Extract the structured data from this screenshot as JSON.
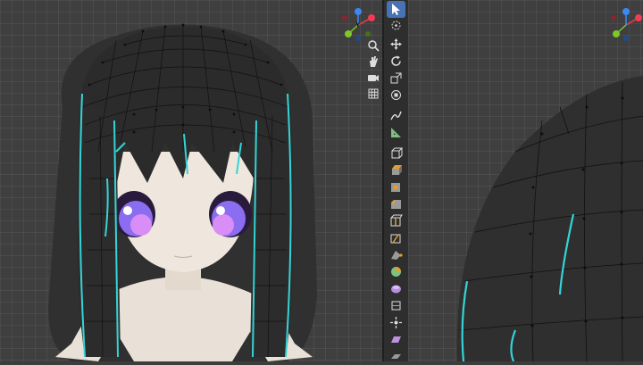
{
  "app": "Blender",
  "colors": {
    "viewport_bg": "#3f3f3f",
    "toolbar_bg": "#2e2e2e",
    "active_tool": "#4772b3",
    "mesh_dark": "#2b2b2b",
    "selected_edge": "#35d3d6",
    "skin": "#efe6dc",
    "eye": "#8a6df0"
  },
  "toolbar": {
    "tools": [
      {
        "name": "select-tool",
        "icon": "cursor-arrow-icon",
        "active": true
      },
      {
        "name": "cursor-tool",
        "icon": "3d-cursor-icon",
        "active": false
      },
      {
        "name": "move-tool",
        "icon": "move-arrows-icon",
        "active": false
      },
      {
        "name": "rotate-tool",
        "icon": "rotate-icon",
        "active": false
      },
      {
        "name": "scale-tool",
        "icon": "scale-icon",
        "active": false
      },
      {
        "name": "transform-tool",
        "icon": "transform-icon",
        "active": false
      },
      {
        "name": "annotate-tool",
        "icon": "pencil-icon",
        "active": false
      },
      {
        "name": "measure-tool",
        "icon": "ruler-icon",
        "active": false
      },
      {
        "name": "add-cube-tool",
        "icon": "add-cube-icon",
        "active": false
      },
      {
        "name": "extrude-tool",
        "icon": "extrude-icon",
        "active": false
      },
      {
        "name": "inset-tool",
        "icon": "inset-faces-icon",
        "active": false
      },
      {
        "name": "bevel-tool",
        "icon": "bevel-icon",
        "active": false
      },
      {
        "name": "loop-cut-tool",
        "icon": "loop-cut-icon",
        "active": false
      },
      {
        "name": "knife-tool",
        "icon": "knife-icon",
        "active": false
      },
      {
        "name": "poly-build-tool",
        "icon": "poly-build-icon",
        "active": false
      },
      {
        "name": "spin-tool",
        "icon": "spin-icon",
        "active": false
      },
      {
        "name": "smooth-tool",
        "icon": "smooth-vertices-icon",
        "active": false
      },
      {
        "name": "edge-slide-tool",
        "icon": "edge-slide-icon",
        "active": false
      },
      {
        "name": "shrink-fatten-tool",
        "icon": "shrink-fatten-icon",
        "active": false
      },
      {
        "name": "shear-tool",
        "icon": "shear-icon",
        "active": false
      },
      {
        "name": "rip-region-tool",
        "icon": "rip-region-icon",
        "active": false
      }
    ]
  },
  "navigation": {
    "buttons": [
      {
        "name": "zoom-button",
        "icon": "magnifier-icon"
      },
      {
        "name": "pan-button",
        "icon": "hand-icon"
      },
      {
        "name": "camera-view-button",
        "icon": "camera-icon"
      },
      {
        "name": "perspective-toggle-button",
        "icon": "grid-icon"
      }
    ]
  },
  "gizmo": {
    "axes": [
      {
        "axis": "X",
        "color": "#f03c52"
      },
      {
        "axis": "Y",
        "color": "#7ec72a"
      },
      {
        "axis": "Z",
        "color": "#3c88f0"
      }
    ]
  }
}
